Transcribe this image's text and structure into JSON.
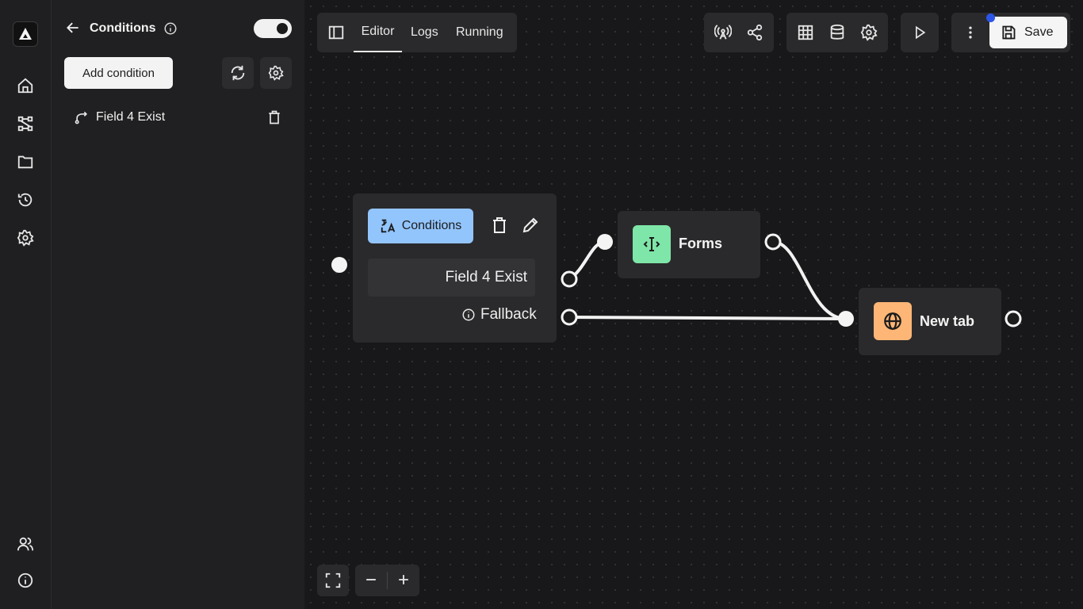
{
  "sidebar": {
    "items": [
      "home-icon",
      "workflow-icon",
      "folder-icon",
      "history-icon",
      "settings-icon"
    ],
    "bottom_items": [
      "users-icon",
      "info-icon"
    ]
  },
  "panel": {
    "title": "Conditions",
    "toggle_on": true,
    "add_condition_label": "Add condition",
    "conditions": [
      {
        "label": "Field 4 Exist"
      }
    ]
  },
  "toolbar": {
    "tabs": [
      "Editor",
      "Logs",
      "Running"
    ],
    "active_tab": "Editor",
    "save_label": "Save",
    "has_unsaved_indicator": true
  },
  "canvas": {
    "conditions_node": {
      "badge_label": "Conditions",
      "branch_label": "Field 4 Exist",
      "fallback_label": "Fallback"
    },
    "forms_node": {
      "title": "Forms",
      "accent": "#7ee6a8"
    },
    "newtab_node": {
      "title": "New tab",
      "accent": "#fdb676"
    },
    "conditions_accent": "#93c5fd"
  }
}
